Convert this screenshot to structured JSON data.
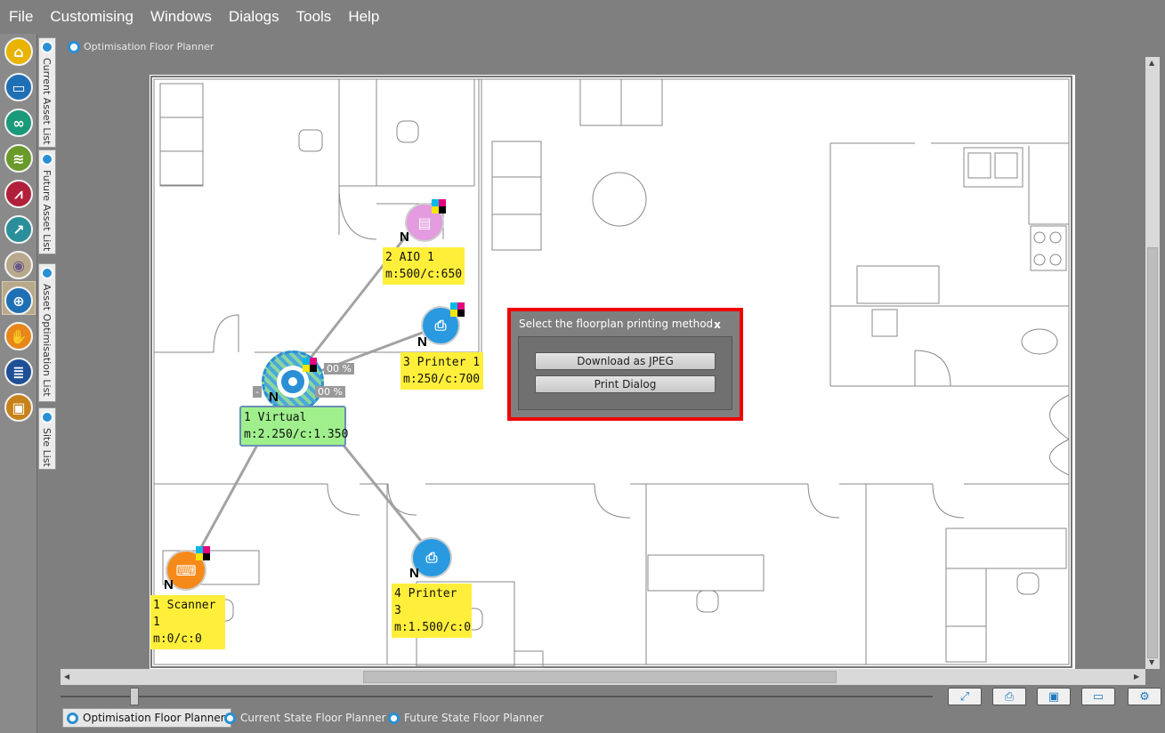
{
  "menu": [
    "File",
    "Customising",
    "Windows",
    "Dialogs",
    "Tools",
    "Help"
  ],
  "left_icons": [
    {
      "name": "home-icon",
      "color": "#e8b400",
      "glyph": "⌂"
    },
    {
      "name": "folder-icon",
      "color": "#1f6fb5",
      "glyph": "▭"
    },
    {
      "name": "binoculars-icon",
      "color": "#1a9a7a",
      "glyph": "∞"
    },
    {
      "name": "scroll-icon",
      "color": "#6a9a2a",
      "glyph": "≋"
    },
    {
      "name": "chart-icon",
      "color": "#b0203a",
      "glyph": "⩘"
    },
    {
      "name": "trend-icon",
      "color": "#2a8f9a",
      "glyph": "↗"
    },
    {
      "name": "eye-icon",
      "color": "#b8a98c",
      "glyph": "◉"
    },
    {
      "name": "target-icon",
      "color": "#1f6fb5",
      "glyph": "⊕"
    },
    {
      "name": "handshake-icon",
      "color": "#e8861a",
      "glyph": "✋"
    },
    {
      "name": "document-icon",
      "color": "#1f4f95",
      "glyph": "≣"
    },
    {
      "name": "briefcase-icon",
      "color": "#c7821a",
      "glyph": "▣"
    }
  ],
  "side_tabs": [
    "Current Asset List",
    "Future Asset List",
    "Asset Optimisation List",
    "Site List"
  ],
  "header_title": "Optimisation Floor Planner",
  "dialog": {
    "title": "Select the floorplan printing method",
    "close": "x",
    "btn_jpeg": "Download as JPEG",
    "btn_print": "Print Dialog"
  },
  "nodes": {
    "aio": {
      "line1": "2 AIO 1",
      "line2": "m:500/c:650"
    },
    "printer1": {
      "line1": "3 Printer 1",
      "line2": "m:250/c:700"
    },
    "virtual": {
      "line1": "1 Virtual",
      "line2": "m:2.250/c:1.350"
    },
    "scanner": {
      "line1": "1 Scanner 1",
      "line2": "m:0/c:0"
    },
    "printer3": {
      "line1": "4 Printer 3",
      "line2": "m:1.500/c:0"
    }
  },
  "n_marker": "N",
  "pct_a": "00 %",
  "pct_b": "00 %",
  "pct_minus": "-",
  "bottom_tabs": [
    "Optimisation Floor Planner",
    "Current State Floor Planner",
    "Future State Floor Planner"
  ],
  "colors": {
    "accent": "#2a8fd4",
    "dialog_border": "#e00000",
    "label_yellow": "#ffef3a",
    "label_green": "#9ff08c"
  }
}
